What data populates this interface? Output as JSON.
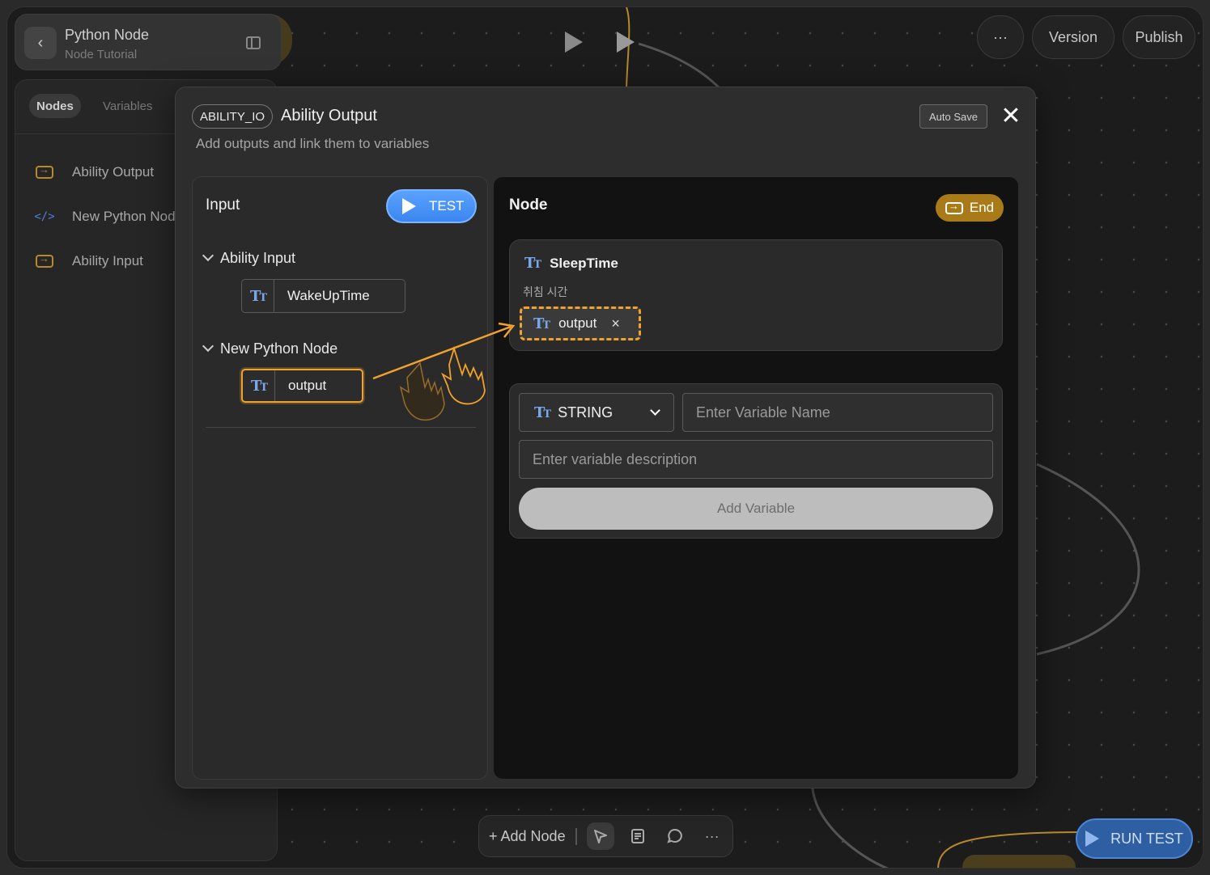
{
  "header": {
    "title": "Python Node",
    "subtitle": "Node Tutorial",
    "back_icon": "chevron-left-icon",
    "panel_icon": "sidebar-toggle-icon"
  },
  "top_actions": {
    "more_label": "···",
    "version_label": "Version",
    "publish_label": "Publish"
  },
  "sidebar": {
    "tabs": [
      {
        "label": "Nodes",
        "active": true
      },
      {
        "label": "Variables",
        "active": false
      }
    ],
    "items": [
      {
        "label": "Ability Output",
        "icon": "io-output-icon"
      },
      {
        "label": "New Python Node",
        "icon": "code-icon"
      },
      {
        "label": "Ability Input",
        "icon": "io-input-icon"
      }
    ]
  },
  "modal": {
    "badge": "ABILITY_IO",
    "title": "Ability Output",
    "subtitle": "Add outputs and link them to variables",
    "auto_save": "Auto Save",
    "close_icon": "close-icon",
    "input_panel": {
      "title": "Input",
      "test_label": "TEST",
      "groups": [
        {
          "label": "Ability Input",
          "vars": [
            "WakeUpTime"
          ]
        },
        {
          "label": "New Python Node",
          "vars": [
            "output"
          ]
        }
      ]
    },
    "node_panel": {
      "title": "Node",
      "end_label": "End",
      "variable": {
        "name": "SleepTime",
        "description": "취침 시간",
        "linked": "output",
        "remove_glyph": "×"
      },
      "add_form": {
        "type_value": "STRING",
        "name_placeholder": "Enter Variable Name",
        "description_placeholder": "Enter variable description",
        "add_label": "Add Variable"
      }
    }
  },
  "toolbar": {
    "add_node_label": "+ Add Node",
    "icons": [
      "pointer-icon",
      "note-icon",
      "comment-icon",
      "more-icon"
    ],
    "more_glyph": "···"
  },
  "run_test_label": "RUN TEST",
  "colors": {
    "accent_orange": "#f0a22b",
    "accent_gold": "#a97b18",
    "accent_blue": "#3b86ef"
  }
}
